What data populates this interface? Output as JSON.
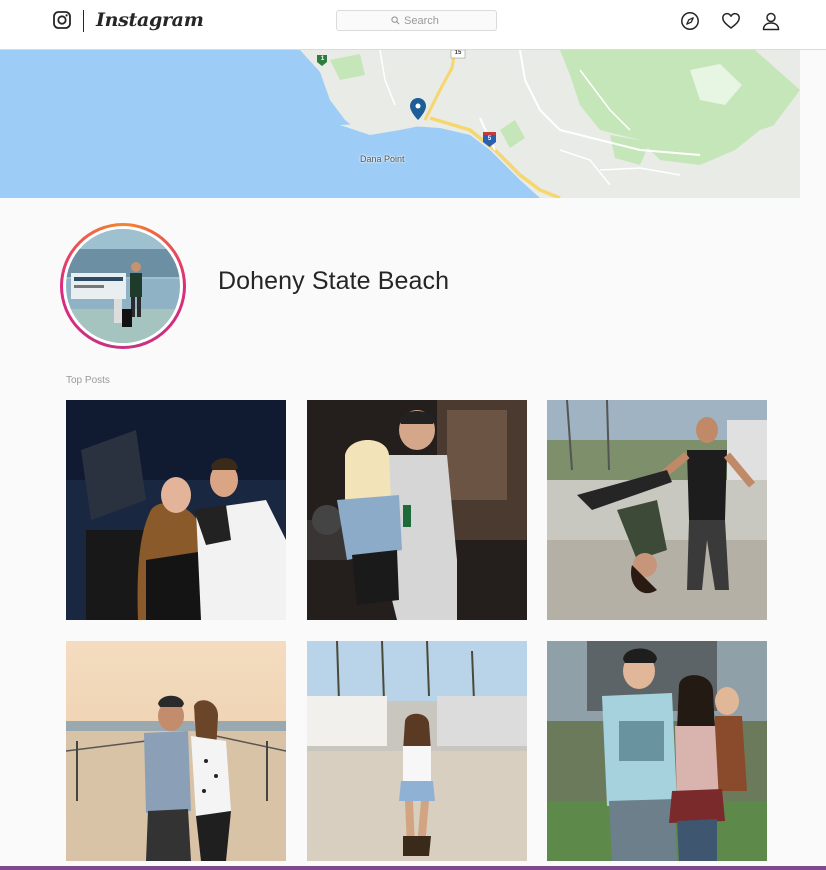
{
  "header": {
    "brand": "Instagram",
    "search_placeholder": "Search"
  },
  "map": {
    "city_label": "Dana Point",
    "route_15": "15",
    "route_5": "5",
    "route_1": "1",
    "colors": {
      "water": "#9dcdf7",
      "land": "#e8ebe6",
      "park": "#c4e6b8",
      "highway": "#f5d76e",
      "pin": "#1f5d99"
    }
  },
  "location": {
    "name": "Doheny State Beach"
  },
  "top_posts": {
    "label": "Top Posts",
    "posts": [
      {
        "icon": "photo-couple-concert-night"
      },
      {
        "icon": "photo-couple-bar-night"
      },
      {
        "icon": "photo-dance-outdoor-festival"
      },
      {
        "icon": "photo-couple-beach-sunset"
      },
      {
        "icon": "photo-woman-beach-festival"
      },
      {
        "icon": "photo-couple-park-festival"
      }
    ]
  }
}
